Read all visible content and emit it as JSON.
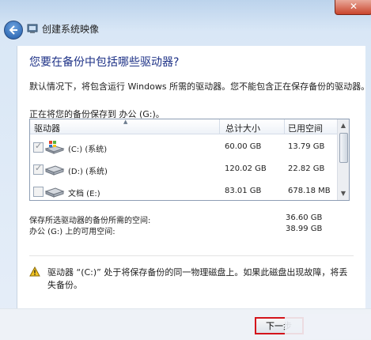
{
  "window": {
    "title": "创建系统映像"
  },
  "heading": "您要在备份中包括哪些驱动器?",
  "description": "默认情况下，将包含运行 Windows 所需的驱动器。您不能包含正在保存备份的驱动器。",
  "saving_to": "正在将您的备份保存到 办公 (G:)。",
  "table": {
    "columns": [
      "驱动器",
      "总计大小",
      "已用空间"
    ],
    "rows": [
      {
        "checked": true,
        "name": "(C:) (系统)",
        "total": "60.00 GB",
        "used": "13.79 GB"
      },
      {
        "checked": true,
        "name": "(D:) (系统)",
        "total": "120.02 GB",
        "used": "22.82 GB"
      },
      {
        "checked": false,
        "name": "文档 (E:)",
        "total": "83.01 GB",
        "used": "678.18 MB"
      }
    ]
  },
  "summary": [
    {
      "label": "保存所选驱动器的备份所需的空间:",
      "value": "36.60 GB"
    },
    {
      "label": "办公 (G:) 上的可用空间:",
      "value": "38.99 GB"
    }
  ],
  "warning": "驱动器 “(C:)” 处于将保存备份的同一物理磁盘上。如果此磁盘出现故障，将丢失备份。",
  "buttons": {
    "next": "下一步",
    "close": "✕"
  },
  "icons": {
    "back": "back-arrow-icon",
    "app": "system-image-icon",
    "warning": "warning-icon",
    "drive": "hard-drive-icon"
  }
}
